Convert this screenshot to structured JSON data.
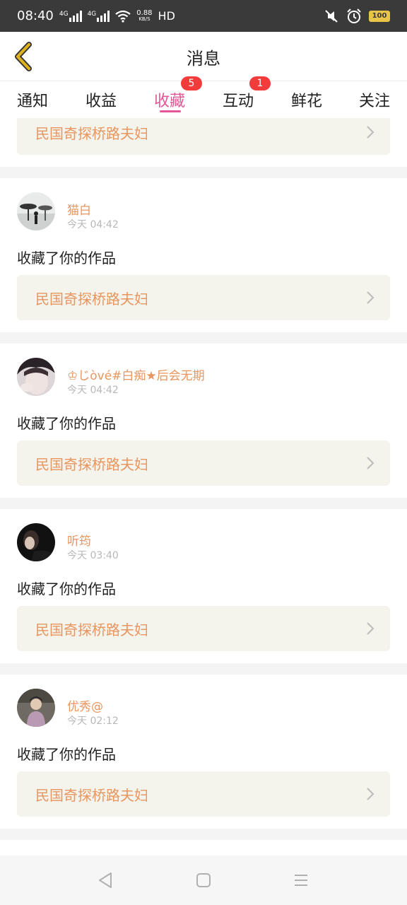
{
  "status": {
    "time": "08:40",
    "net1": "4G",
    "net2": "4G",
    "speed_value": "0.88",
    "speed_unit": "KB/S",
    "hd": "HD",
    "battery": "100"
  },
  "header": {
    "title": "消息"
  },
  "tabs": [
    {
      "label": "通知"
    },
    {
      "label": "收益"
    },
    {
      "label": "收藏",
      "badge": "5"
    },
    {
      "label": "互动",
      "badge": "1"
    },
    {
      "label": "鲜花"
    },
    {
      "label": "关注"
    }
  ],
  "first_card": {
    "work_title": "民国奇探桥路夫妇"
  },
  "entries": [
    {
      "name": "猫白",
      "time": "今天 04:42",
      "action": "收藏了你的作品",
      "work_title": "民国奇探桥路夫妇"
    },
    {
      "name": "♔じòvé#白痴★后会无期",
      "time": "今天 04:42",
      "action": "收藏了你的作品",
      "work_title": "民国奇探桥路夫妇"
    },
    {
      "name": "听筠",
      "time": "今天 03:40",
      "action": "收藏了你的作品",
      "work_title": "民国奇探桥路夫妇"
    },
    {
      "name": "优秀@",
      "time": "今天 02:12",
      "action": "收藏了你的作品",
      "work_title": "民国奇探桥路夫妇"
    }
  ],
  "icons": {
    "back": "chevron-left-icon",
    "chevron": "chevron-right-icon",
    "nav_back": "triangle-back-icon",
    "nav_home": "square-home-icon",
    "nav_menu": "menu-icon"
  },
  "colors": {
    "accent": "#e35596",
    "name": "#e8955f",
    "badge": "#f23b3b",
    "back_arrow": "#e0b21c"
  }
}
